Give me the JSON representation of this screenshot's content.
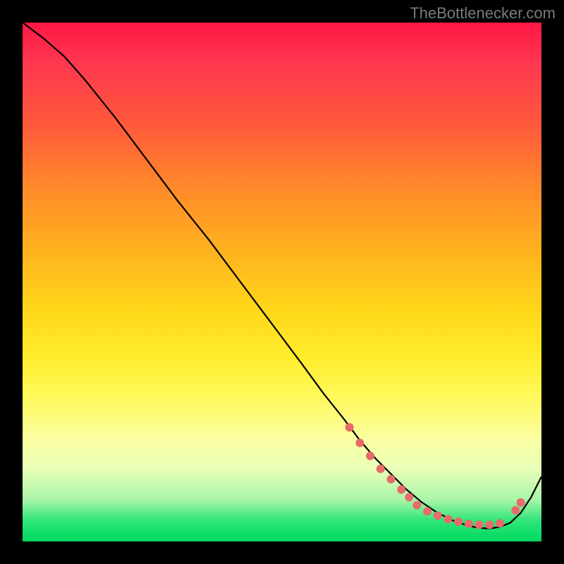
{
  "attribution": "TheBottlenecker.com",
  "colors": {
    "frame": "#000000",
    "curve": "#000000",
    "dots": "#e86a6a",
    "gradient_top": "#ff1744",
    "gradient_bottom": "#00d860"
  },
  "chart_data": {
    "type": "line",
    "title": "",
    "xlabel": "",
    "ylabel": "",
    "xlim": [
      0,
      100
    ],
    "ylim": [
      0,
      100
    ],
    "x": [
      0,
      4,
      8,
      12,
      18,
      24,
      30,
      36,
      42,
      48,
      54,
      58,
      62,
      65,
      68,
      71,
      74,
      77,
      80,
      83,
      86,
      88,
      90,
      92,
      94,
      96,
      98,
      100
    ],
    "y": [
      100,
      97,
      93.5,
      89,
      81.5,
      73.5,
      65.5,
      58,
      50,
      42,
      34,
      28.5,
      23.5,
      19.5,
      16,
      13,
      10,
      7.5,
      5.5,
      4,
      3,
      2.6,
      2.5,
      2.8,
      3.6,
      5.5,
      8.5,
      12.5
    ],
    "highlight_points": [
      {
        "x": 63,
        "y": 22
      },
      {
        "x": 65,
        "y": 19
      },
      {
        "x": 67,
        "y": 16.5
      },
      {
        "x": 69,
        "y": 14
      },
      {
        "x": 71,
        "y": 12
      },
      {
        "x": 73,
        "y": 10
      },
      {
        "x": 74.5,
        "y": 8.5
      },
      {
        "x": 76,
        "y": 7
      },
      {
        "x": 78,
        "y": 5.8
      },
      {
        "x": 80,
        "y": 5
      },
      {
        "x": 82,
        "y": 4.3
      },
      {
        "x": 84,
        "y": 3.8
      },
      {
        "x": 86,
        "y": 3.4
      },
      {
        "x": 88,
        "y": 3.2
      },
      {
        "x": 90,
        "y": 3.2
      },
      {
        "x": 92,
        "y": 3.5
      },
      {
        "x": 95,
        "y": 6
      },
      {
        "x": 96,
        "y": 7.5
      }
    ]
  }
}
